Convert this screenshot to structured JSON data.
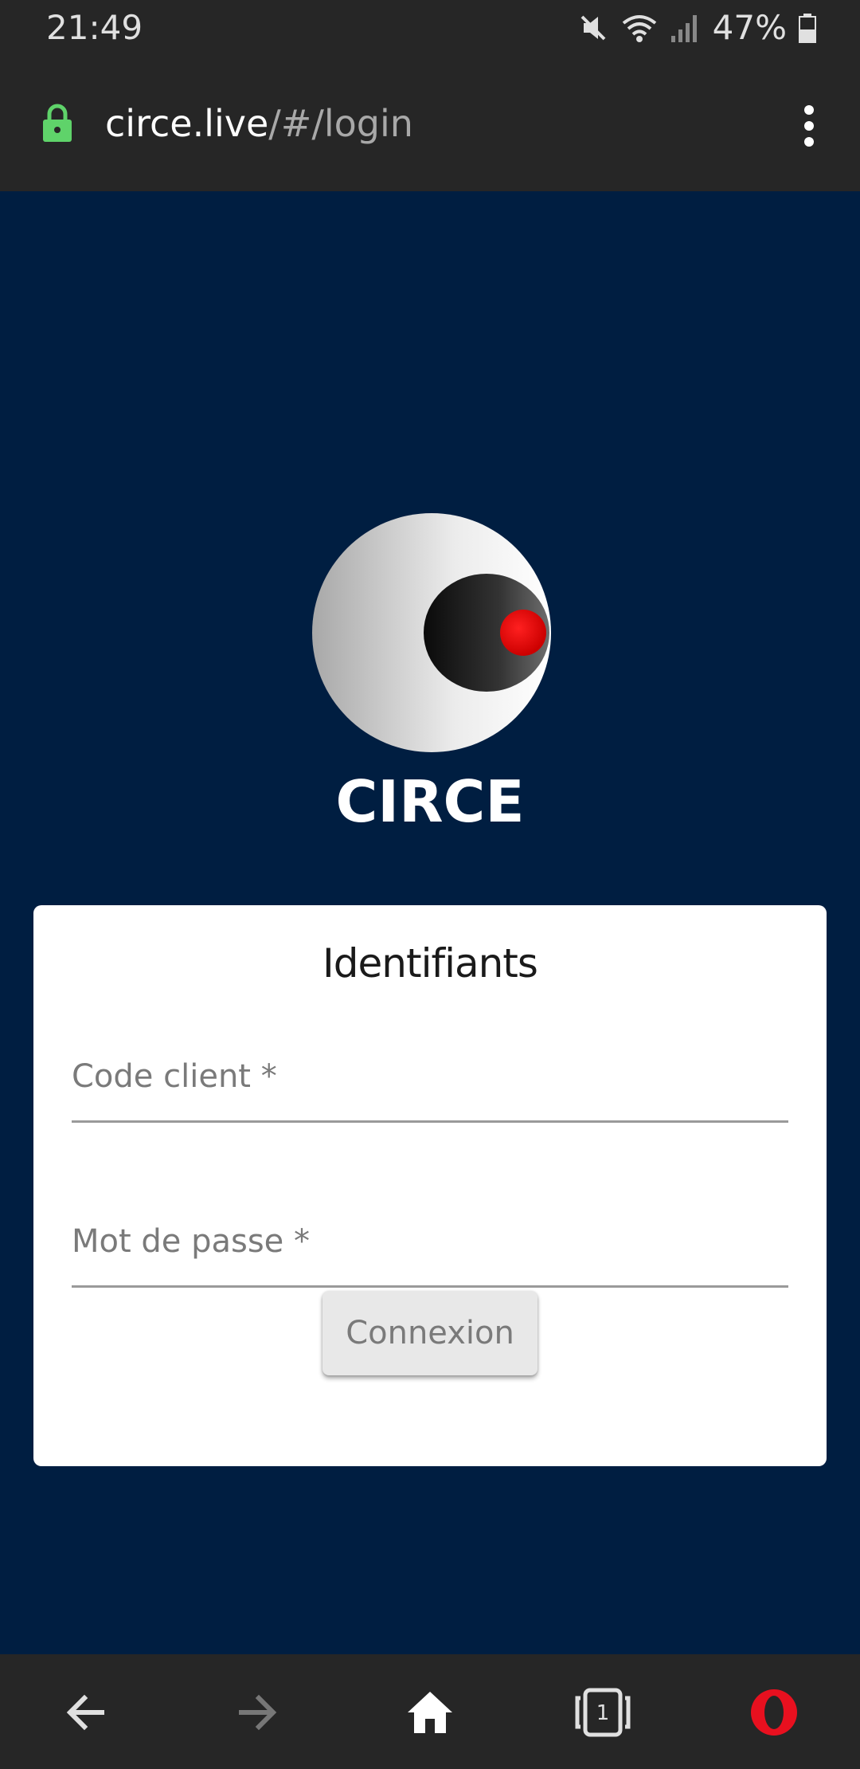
{
  "status_bar": {
    "time": "21:49",
    "battery": "47%",
    "icons": [
      "mute-icon",
      "wifi-icon",
      "signal-icon",
      "battery-icon"
    ]
  },
  "browser": {
    "url_host": "circe.live",
    "url_path": "/#/login"
  },
  "app": {
    "title": "CIRCE"
  },
  "login_card": {
    "title": "Identifiants",
    "code_client_label": "Code client *",
    "password_label": "Mot de passe *",
    "submit_label": "Connexion"
  },
  "nav": {
    "tab_count": "1",
    "icons": [
      "back-icon",
      "forward-icon",
      "home-icon",
      "tabs-icon",
      "opera-icon"
    ]
  },
  "colors": {
    "page_background": "#001e41",
    "browser_chrome": "#262626",
    "lock_green": "#5fd36a",
    "logo_red": "#ff0000",
    "opera_red": "#e8101f"
  }
}
